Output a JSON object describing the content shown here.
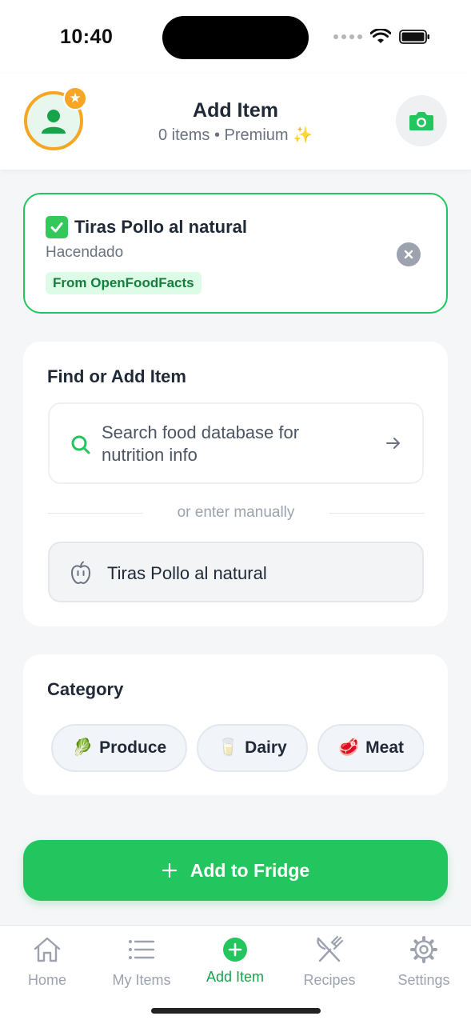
{
  "status_bar": {
    "time": "10:40"
  },
  "header": {
    "title": "Add Item",
    "subtitle": "0 items • Premium ✨",
    "avatar_icon": "user-icon",
    "badge_icon": "star-icon",
    "camera_icon": "camera-icon"
  },
  "selected_product": {
    "name": "Tiras Pollo al natural",
    "brand": "Hacendado",
    "source_tag": "From OpenFoodFacts"
  },
  "find_section": {
    "title": "Find or Add Item",
    "search_placeholder": "Search food database for nutrition info",
    "divider_text": "or enter manually",
    "manual_value": "Tiras Pollo al natural"
  },
  "category_section": {
    "title": "Category",
    "chips": [
      {
        "emoji": "🥬",
        "label": "Produce"
      },
      {
        "emoji": "🥛",
        "label": "Dairy"
      },
      {
        "emoji": "🥩",
        "label": "Meat"
      }
    ]
  },
  "primary_action": {
    "label": "Add to Fridge"
  },
  "tabbar": {
    "items": [
      {
        "label": "Home",
        "icon": "home-icon"
      },
      {
        "label": "My Items",
        "icon": "list-icon"
      },
      {
        "label": "Add Item",
        "icon": "plus-circle-icon"
      },
      {
        "label": "Recipes",
        "icon": "utensils-icon"
      },
      {
        "label": "Settings",
        "icon": "gear-icon"
      }
    ],
    "active": "Add Item"
  },
  "colors": {
    "accent": "#22c55e",
    "accent_dark": "#16a34a",
    "premium": "#f6a623",
    "tag_bg": "#dcfce7",
    "inactive": "#9ca3af"
  }
}
